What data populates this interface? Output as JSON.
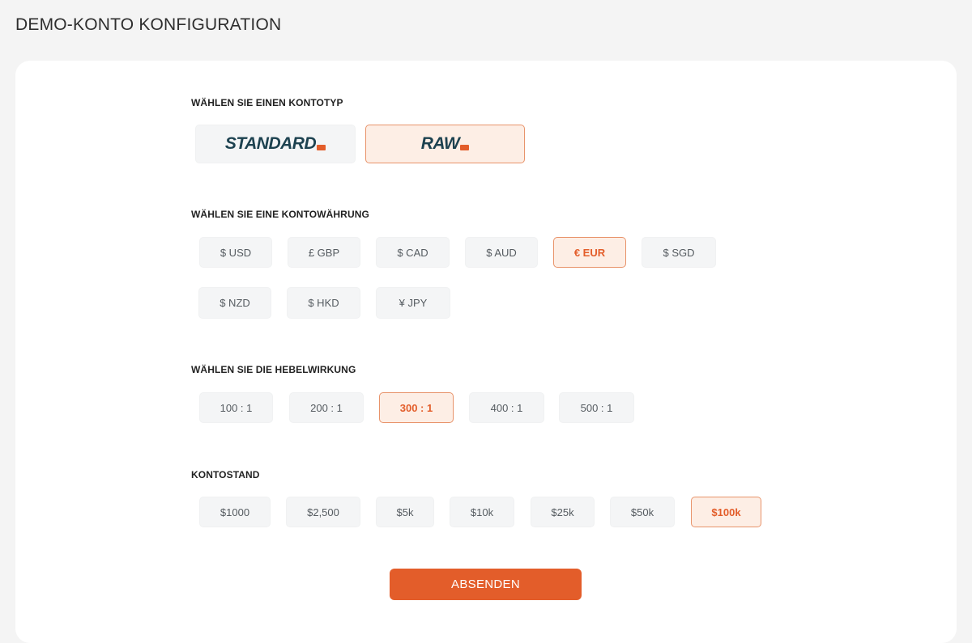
{
  "page": {
    "title": "DEMO-KONTO KONFIGURATION"
  },
  "account_type": {
    "label": "WÄHLEN SIE EINEN KONTOTYP",
    "options": [
      {
        "name": "STANDARD",
        "tag": "",
        "selected": false
      },
      {
        "name": "RAW",
        "tag": "",
        "selected": true
      }
    ]
  },
  "currency": {
    "label": "WÄHLEN SIE EINE KONTOWÄHRUNG",
    "options": [
      {
        "label": "$ USD",
        "selected": false
      },
      {
        "label": "£ GBP",
        "selected": false
      },
      {
        "label": "$ CAD",
        "selected": false
      },
      {
        "label": "$ AUD",
        "selected": false
      },
      {
        "label": "€ EUR",
        "selected": true
      },
      {
        "label": "$ SGD",
        "selected": false
      },
      {
        "label": "$ NZD",
        "selected": false
      },
      {
        "label": "$ HKD",
        "selected": false
      },
      {
        "label": "¥ JPY",
        "selected": false
      }
    ]
  },
  "leverage": {
    "label": "WÄHLEN SIE DIE HEBELWIRKUNG",
    "options": [
      {
        "label": "100 : 1",
        "selected": false
      },
      {
        "label": "200 : 1",
        "selected": false
      },
      {
        "label": "300 : 1",
        "selected": true
      },
      {
        "label": "400 : 1",
        "selected": false
      },
      {
        "label": "500 : 1",
        "selected": false
      }
    ]
  },
  "balance": {
    "label": "KONTOSTAND",
    "options": [
      {
        "label": "$1000",
        "selected": false
      },
      {
        "label": "$2,500",
        "selected": false
      },
      {
        "label": "$5k",
        "selected": false
      },
      {
        "label": "$10k",
        "selected": false
      },
      {
        "label": "$25k",
        "selected": false
      },
      {
        "label": "$50k",
        "selected": false
      },
      {
        "label": "$100k",
        "selected": true
      }
    ]
  },
  "submit": {
    "label": "ABSENDEN"
  },
  "colors": {
    "accent": "#e35d2a",
    "selected_bg": "#fdeee5",
    "selected_border": "#e8936a",
    "option_bg": "#f4f5f6",
    "logo_text": "#1d4250"
  }
}
